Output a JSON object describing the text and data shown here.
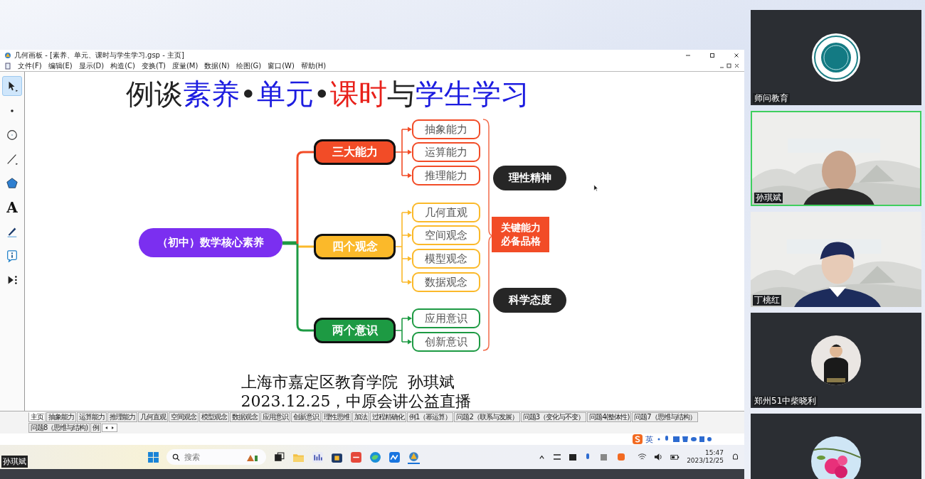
{
  "window": {
    "title": "几何画板 - [素养、单元、课时与学生学习.gsp - 主页]"
  },
  "menu": [
    "文件(F)",
    "编辑(E)",
    "显示(D)",
    "构造(C)",
    "变换(T)",
    "度量(M)",
    "数据(N)",
    "绘图(G)",
    "窗口(W)",
    "帮助(H)"
  ],
  "tools": [
    {
      "kind": "arrow",
      "selected": true
    },
    {
      "kind": "point",
      "selected": false
    },
    {
      "kind": "compass",
      "selected": false
    },
    {
      "kind": "line",
      "selected": false
    },
    {
      "kind": "polygon",
      "selected": false
    },
    {
      "kind": "text",
      "label": "A",
      "selected": false
    },
    {
      "kind": "marker",
      "selected": false
    },
    {
      "kind": "info",
      "selected": false
    },
    {
      "kind": "custom",
      "selected": false
    }
  ],
  "slide": {
    "title": [
      {
        "text": "例谈",
        "color": "#222222"
      },
      {
        "text": "素养",
        "color": "#1c1ce0"
      },
      {
        "text": "•",
        "color": "#222222"
      },
      {
        "text": "单元",
        "color": "#1c1ce0"
      },
      {
        "text": "•",
        "color": "#222222"
      },
      {
        "text": "课时",
        "color": "#e8201a"
      },
      {
        "text": "与",
        "color": "#222222"
      },
      {
        "text": "学生学习",
        "color": "#1c1ce0"
      }
    ],
    "mindmap": {
      "root": "（初中）数学核心素养",
      "branches": [
        {
          "label": "三大能力",
          "color": "#f24c27",
          "children": [
            "抽象能力",
            "运算能力",
            "推理能力"
          ]
        },
        {
          "label": "四个观念",
          "color": "#fbb92a",
          "children": [
            "几何直观",
            "空间观念",
            "模型观念",
            "数据观念"
          ]
        },
        {
          "label": "两个意识",
          "color": "#1d9a43",
          "children": [
            "应用意识",
            "创新意识"
          ]
        }
      ],
      "summary": [
        {
          "kind": "pill",
          "text": "理性精神"
        },
        {
          "kind": "box",
          "lines": [
            "关键能力",
            "必备品格"
          ]
        },
        {
          "kind": "pill",
          "text": "科学态度"
        }
      ]
    },
    "author": [
      "上海市嘉定区教育学院  孙琪斌",
      "2023.12.25，中原会讲公益直播"
    ]
  },
  "page_tabs": [
    {
      "label": "主页",
      "selected": true
    },
    {
      "label": "抽象能力",
      "selected": false
    },
    {
      "label": "运算能力",
      "selected": false
    },
    {
      "label": "推理能力",
      "selected": false
    },
    {
      "label": "几何直观",
      "selected": false
    },
    {
      "label": "空间观念",
      "selected": false
    },
    {
      "label": "模型观念",
      "selected": false
    },
    {
      "label": "数据观念",
      "selected": false
    },
    {
      "label": "应用意识",
      "selected": false
    },
    {
      "label": "创新意识",
      "selected": false
    },
    {
      "label": "理性思维",
      "selected": false
    },
    {
      "label": "加法",
      "selected": false
    },
    {
      "label": "过程精确化",
      "selected": false
    },
    {
      "label": "例1（幂运算）",
      "selected": false
    },
    {
      "label": "问题2（联系与发展）",
      "selected": false
    },
    {
      "label": "问题3（变化与不变）",
      "selected": false
    },
    {
      "label": "问题4(整体性)",
      "selected": false
    },
    {
      "label": "问题7（思维与结构）",
      "selected": false
    },
    {
      "label": "问题8（思维与结构)",
      "selected": false
    },
    {
      "label": "例",
      "selected": false
    }
  ],
  "ime_bar": {
    "language": "英"
  },
  "video_label": "孙琪斌",
  "taskbar": {
    "search": {
      "placeholder": "搜索"
    },
    "time": "15:47",
    "date": "2023/12/25"
  },
  "participants": [
    {
      "name": "师问教育",
      "kind": "logo",
      "selected": false
    },
    {
      "name": "孙琪斌",
      "kind": "video",
      "selected": true
    },
    {
      "name": "丁桃红",
      "kind": "video",
      "selected": false
    },
    {
      "name": "郑州51中柴晓利",
      "kind": "avatar",
      "selected": false
    },
    {
      "kind": "avatar",
      "selected": false
    }
  ]
}
